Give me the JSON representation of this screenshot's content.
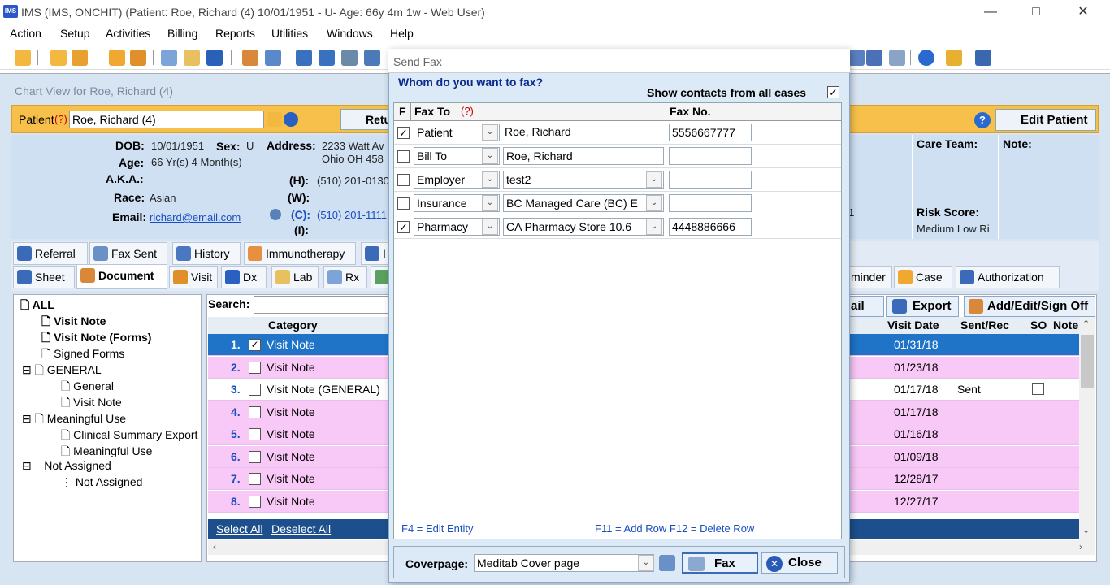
{
  "window": {
    "title": "IMS (IMS, ONCHIT)     (Patient: Roe, Richard  (4) 10/01/1951 - U- Age: 66y 4m 1w - Web User)",
    "logo_text": "IMS"
  },
  "menu": [
    "Action",
    "Setup",
    "Activities",
    "Billing",
    "Reports",
    "Utilities",
    "Windows",
    "Help"
  ],
  "chart": {
    "title": "Chart View for Roe, Richard  (4)",
    "patient_label": "Patient",
    "help_mark": "(?)",
    "patient_value": "Roe, Richard  (4)",
    "return_btn": "Retu",
    "edit_patient_btn": "Edit Patient",
    "dob_label": "DOB:",
    "dob": "10/01/1951",
    "sex_label": "Sex:",
    "sex": "U",
    "age_label": "Age:",
    "age": "66 Yr(s) 4 Month(s)",
    "aka_label": "A.K.A.:",
    "race_label": "Race:",
    "race": "Asian",
    "email_label": "Email:",
    "email": "richard@email.com",
    "address_label": "Address:",
    "address1": "2233 Watt Av",
    "address2": "Ohio  OH  458",
    "home_label": "(H):",
    "home": "(510) 201-0130",
    "work_label": "(W):",
    "cell_label": "(C):",
    "cell": "(510) 201-1111",
    "i_label": "(I):",
    "care_team_label": "Care Team:",
    "note_label": "Note:",
    "risk_label": "Risk Score:",
    "risk_value": "Medium Low Ri",
    "stray_digit": "1"
  },
  "tabs_row1": [
    "Referral",
    "Fax Sent",
    "History",
    "Immunotherapy",
    "I"
  ],
  "tabs_row2": [
    "Sheet",
    "Document",
    "Visit",
    "Dx",
    "Lab",
    "Rx"
  ],
  "tabs_row2_right": [
    "minder",
    "Case",
    "Authorization"
  ],
  "tree": [
    {
      "label": "ALL",
      "bold": true
    },
    {
      "label": "Visit Note",
      "bold": true
    },
    {
      "label": "Visit Note (Forms)",
      "bold": true
    },
    {
      "label": "Signed Forms"
    },
    {
      "label": "GENERAL"
    },
    {
      "label": "General"
    },
    {
      "label": "Visit Note"
    },
    {
      "label": "Meaningful Use"
    },
    {
      "label": "Clinical Summary Export"
    },
    {
      "label": "Meaningful Use"
    },
    {
      "label": "Not Assigned"
    },
    {
      "label": "Not Assigned"
    }
  ],
  "docs": {
    "search_label": "Search:",
    "email_btn": "ail",
    "export_btn": "Export",
    "sign_btn": "Add/Edit/Sign Off",
    "col_category": "Category",
    "col_visit_date": "Visit Date",
    "col_sent": "Sent/Rec",
    "col_so": "SO",
    "col_note": "Note",
    "select_all": "Select All",
    "deselect_all": "Deselect All",
    "rows": [
      {
        "n": "1.",
        "cat": "Visit Note",
        "date": "01/31/18",
        "sent": "",
        "checked": true
      },
      {
        "n": "2.",
        "cat": "Visit Note",
        "date": "01/23/18",
        "sent": ""
      },
      {
        "n": "3.",
        "cat": "Visit Note (GENERAL)",
        "date": "01/17/18",
        "sent": "Sent"
      },
      {
        "n": "4.",
        "cat": "Visit Note",
        "date": "01/17/18",
        "sent": ""
      },
      {
        "n": "5.",
        "cat": "Visit Note",
        "date": "01/16/18",
        "sent": ""
      },
      {
        "n": "6.",
        "cat": "Visit Note",
        "date": "01/09/18",
        "sent": ""
      },
      {
        "n": "7.",
        "cat": "Visit Note",
        "date": "12/28/17",
        "sent": ""
      },
      {
        "n": "8.",
        "cat": "Visit Note",
        "date": "12/27/17",
        "sent": ""
      }
    ]
  },
  "fax": {
    "title": "Send Fax",
    "question": "Whom do you want to fax?",
    "show_contacts": "Show contacts from all cases",
    "col_f": "F",
    "col_fax_to": "Fax To",
    "col_help": "(?)",
    "col_fax_no": "Fax No.",
    "rows": [
      {
        "type": "Patient",
        "name": "Roe, Richard",
        "fax": "5556667777",
        "checked": true,
        "name_dd": false
      },
      {
        "type": "Bill To",
        "name": "Roe, Richard",
        "fax": "",
        "checked": false,
        "name_dd": false
      },
      {
        "type": "Employer",
        "name": "test2",
        "fax": "",
        "checked": false,
        "name_dd": true
      },
      {
        "type": "Insurance",
        "name": "BC Managed Care  (BC)    E",
        "fax": "",
        "checked": false,
        "name_dd": true
      },
      {
        "type": "Pharmacy",
        "name": "CA Pharmacy Store 10.6",
        "fax": "4448886666",
        "checked": true,
        "name_dd": true
      }
    ],
    "hint_f4": "F4 = Edit Entity",
    "hint_f11": "F11 = Add Row  F12 = Delete Row",
    "coverpage_label": "Coverpage:",
    "coverpage_value": "Meditab Cover page",
    "fax_btn": "Fax",
    "close_btn": "Close"
  },
  "colors": {
    "accent": "#1f74c8",
    "pink": "#f8c8f6",
    "patient_bar": "#f7c04a"
  }
}
